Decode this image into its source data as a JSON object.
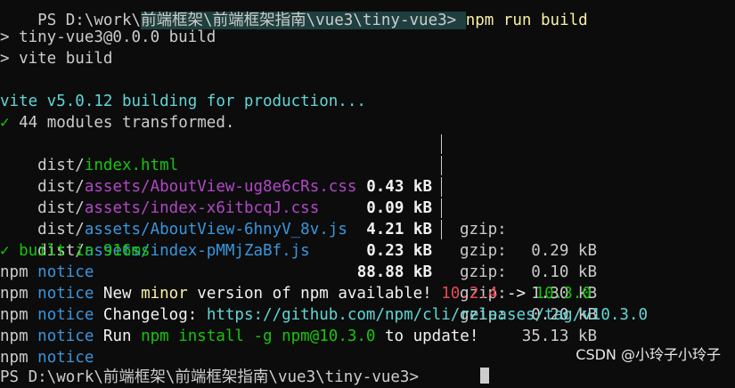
{
  "top_line": {
    "prefix": "PS D:\\work\\",
    "middle": "前端框架\\前端框架指南\\vue3\\tiny-vue3> ",
    "cmd": "npm run build"
  },
  "script_lines": [
    "> tiny-vue3@0.0.0 build",
    "> vite build"
  ],
  "vite": {
    "building": "vite v5.0.12 building for production...",
    "check": "✓",
    "transformed": " 44 modules transformed.",
    "built_check": "✓",
    "built": " built in 916ms"
  },
  "files": [
    {
      "dir": "dist/",
      "name": "index.html",
      "color": "#16c60c",
      "size": "0.43 kB",
      "gzip_label": "gzip:",
      "gzip": "0.29 kB"
    },
    {
      "dir": "dist/",
      "name": "assets/AboutView-ug8e6cRs.css",
      "color": "#b148c6",
      "size": "0.09 kB",
      "gzip_label": "gzip:",
      "gzip": "0.10 kB"
    },
    {
      "dir": "dist/",
      "name": "assets/index-x6itbcqJ.css",
      "color": "#b148c6",
      "size": "4.21 kB",
      "gzip_label": "gzip:",
      "gzip": "1.30 kB"
    },
    {
      "dir": "dist/",
      "name": "assets/AboutView-6hnyV_8v.js",
      "color": "#3a96dd",
      "size": "0.23 kB",
      "gzip_label": "gzip:",
      "gzip": "0.20 kB"
    },
    {
      "dir": "dist/",
      "name": "assets/index-pMMjZaBf.js",
      "color": "#3a96dd",
      "size": "88.88 kB",
      "gzip_label": "gzip:",
      "gzip": "35.13 kB"
    }
  ],
  "npm": {
    "npm": "npm",
    "notice": "notice",
    "new_a": " New ",
    "minor": "minor",
    "new_b": " version of npm available! ",
    "from_version": "10.2.4",
    "arrow": " -> ",
    "to_version": "10.3.0",
    "changelog_label": " Changelog: ",
    "changelog_url": "https://github.com/npm/cli/releases/tag/v10.3.0",
    "run": " Run ",
    "install_cmd": "npm install -g npm@10.3.0",
    "to_update": " to update!"
  },
  "bottom_line": {
    "text": "PS D:\\work\\前端框架\\前端框架指南\\vue3\\tiny-vue3> "
  },
  "watermark": "CSDN @小玲子小玲子"
}
